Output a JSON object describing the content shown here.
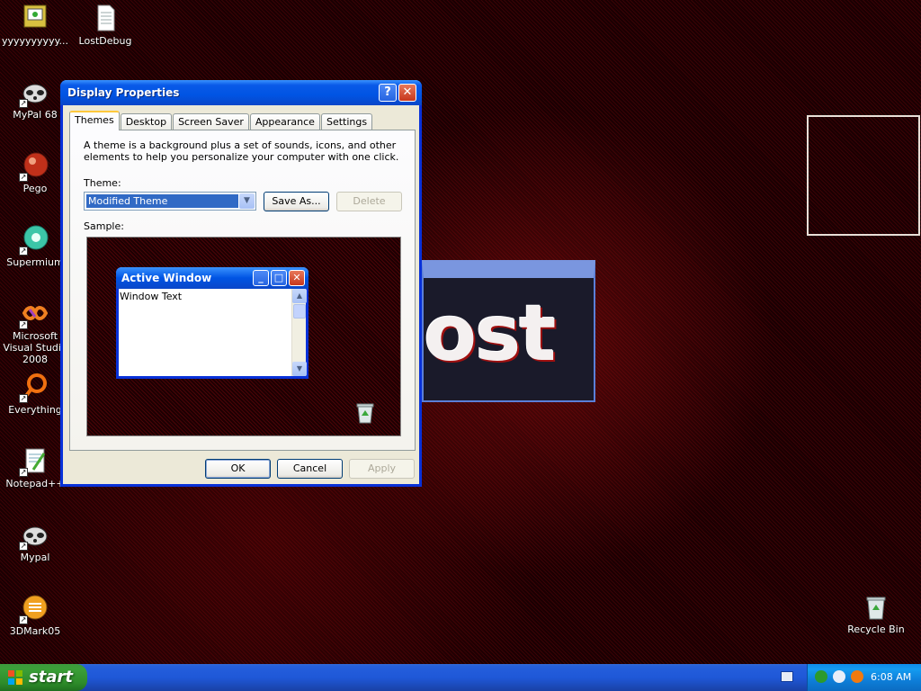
{
  "desktop_icons": [
    {
      "label": "yyyyyyyyyy...",
      "icon": "monitor-settings-icon"
    },
    {
      "label": "LostDebug",
      "icon": "text-file-icon"
    },
    {
      "label": "MyPal 68",
      "icon": "mypal-raccoon-icon"
    },
    {
      "label": "Pego",
      "icon": "pego-ball-icon"
    },
    {
      "label": "Supermium",
      "icon": "supermium-browser-icon"
    },
    {
      "label": "Microsoft Visual Studio 2008",
      "icon": "visual-studio-icon"
    },
    {
      "label": "Everything",
      "icon": "everything-search-icon"
    },
    {
      "label": "Notepad++",
      "icon": "notepad-plus-plus-icon"
    },
    {
      "label": "Mypal",
      "icon": "mypal-raccoon-icon"
    },
    {
      "label": "3DMark05",
      "icon": "3dmark-icon"
    },
    {
      "label": "Recycle Bin",
      "icon": "recycle-bin-icon"
    }
  ],
  "dialog": {
    "title": "Display Properties",
    "help_label": "?",
    "close_label": "✕",
    "tabs": [
      "Themes",
      "Desktop",
      "Screen Saver",
      "Appearance",
      "Settings"
    ],
    "description": "A theme is a background plus a set of sounds, icons, and other elements to help you personalize your computer with one click.",
    "theme_label": "Theme:",
    "theme_value": "Modified Theme",
    "save_as_label": "Save As...",
    "delete_label": "Delete",
    "sample_label": "Sample:",
    "sample_window": {
      "title": "Active Window",
      "text": "Window Text"
    },
    "ok_label": "OK",
    "cancel_label": "Cancel",
    "apply_label": "Apply"
  },
  "splash": {
    "text": "ost"
  },
  "taskbar": {
    "start_label": "start",
    "clock": "6:08 AM"
  },
  "colors": {
    "titlebar": "#0054e3",
    "taskbar": "#245edb",
    "start_button": "#3b9f38",
    "desktop": "#250003"
  }
}
